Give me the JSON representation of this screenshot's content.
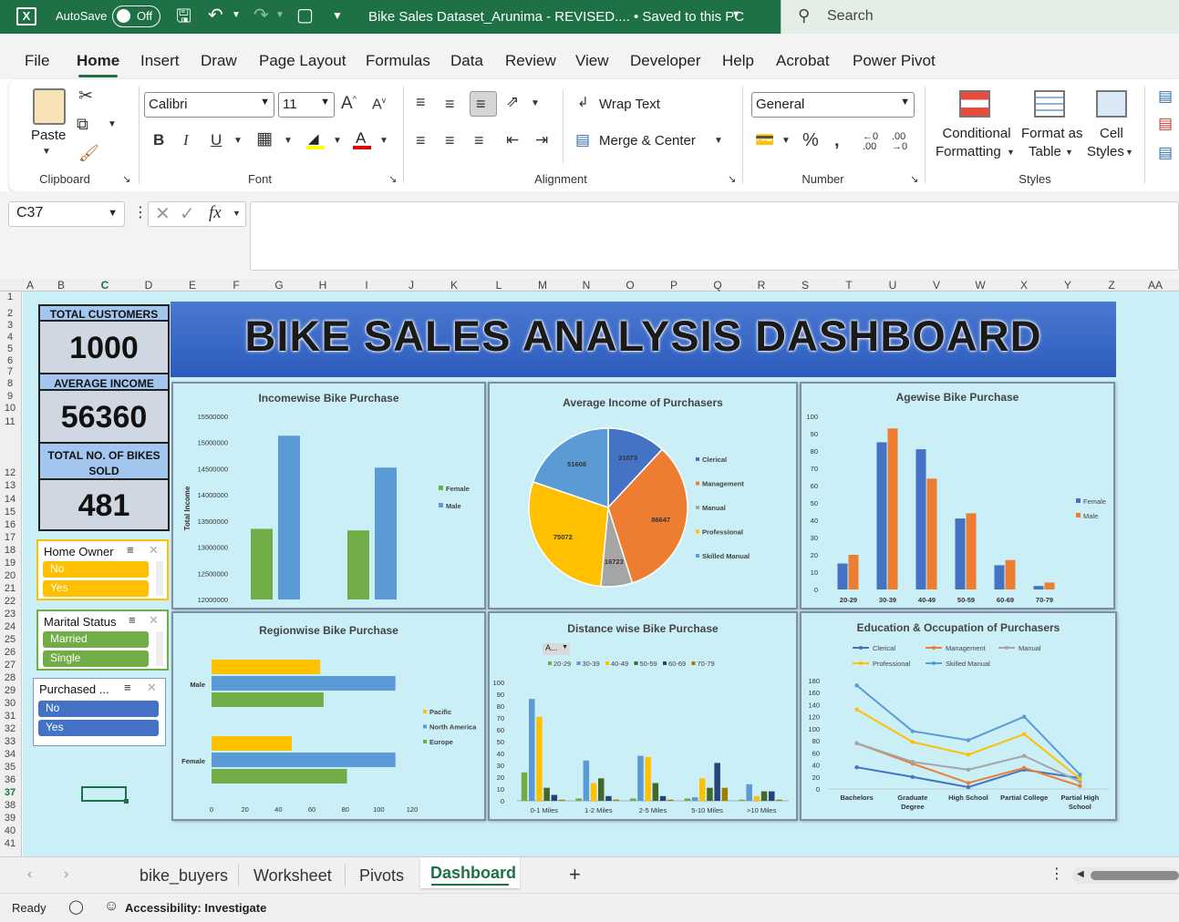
{
  "titlebar": {
    "autosave_label": "AutoSave",
    "autosave_state": "Off",
    "doc_title": "Bike Sales Dataset_Arunima - REVISED.... • Saved to this PC",
    "search_placeholder": "Search"
  },
  "menu": [
    "File",
    "Home",
    "Insert",
    "Draw",
    "Page Layout",
    "Formulas",
    "Data",
    "Review",
    "View",
    "Developer",
    "Help",
    "Acrobat",
    "Power Pivot"
  ],
  "ribbon": {
    "paste": "Paste",
    "clipboard": "Clipboard",
    "font_name": "Calibri",
    "font_size": "11",
    "font": "Font",
    "wrap_text": "Wrap Text",
    "merge_center": "Merge & Center",
    "alignment": "Alignment",
    "number_format": "General",
    "number": "Number",
    "cond_format_1": "Conditional",
    "cond_format_2": "Formatting",
    "format_table_1": "Format as",
    "format_table_2": "Table",
    "cell_styles_1": "Cell",
    "cell_styles_2": "Styles",
    "styles": "Styles"
  },
  "formula": {
    "name_box": "C37",
    "fx": "fx",
    "value": ""
  },
  "columns": [
    "A",
    "B",
    "C",
    "D",
    "E",
    "F",
    "G",
    "H",
    "I",
    "J",
    "K",
    "L",
    "M",
    "N",
    "O",
    "P",
    "Q",
    "R",
    "S",
    "T",
    "U",
    "V",
    "W",
    "X",
    "Y",
    "Z",
    "AA"
  ],
  "rows": [
    "1",
    "2",
    "3",
    "4",
    "5",
    "6",
    "7",
    "8",
    "9",
    "10",
    "11",
    "12",
    "13",
    "14",
    "15",
    "16",
    "17",
    "18",
    "19",
    "20",
    "21",
    "22",
    "23",
    "24",
    "25",
    "26",
    "27",
    "28",
    "29",
    "30",
    "31",
    "32",
    "33",
    "34",
    "35",
    "36",
    "37",
    "38",
    "39",
    "40",
    "41"
  ],
  "kpis": {
    "total_customers_label": "TOTAL CUSTOMERS",
    "total_customers": "1000",
    "avg_income_label": "AVERAGE INCOME",
    "avg_income": "56360",
    "bikes_sold_label_1": "TOTAL NO. OF BIKES",
    "bikes_sold_label_2": "SOLD",
    "bikes_sold": "481"
  },
  "slicers": {
    "home_owner": {
      "title": "Home Owner",
      "items": [
        "No",
        "Yes"
      ],
      "color": "#ffc000"
    },
    "marital_status": {
      "title": "Marital Status",
      "items": [
        "Married",
        "Single"
      ],
      "color": "#70ad47"
    },
    "purchased": {
      "title": "Purchased ...",
      "items": [
        "No",
        "Yes"
      ],
      "color": "#4472c4"
    }
  },
  "dashboard_title": "BIKE SALES ANALYSIS DASHBOARD",
  "charts": {
    "income": {
      "title": "Incomewise Bike Purchase",
      "ylabel": "Total Income",
      "ticks": [
        "15500000",
        "15000000",
        "14500000",
        "14000000",
        "13500000",
        "13000000",
        "12500000",
        "12000000"
      ],
      "legend": [
        "Female",
        "Male"
      ]
    },
    "pie": {
      "title": "Average Income of Purchasers",
      "legend": [
        "Clerical",
        "Management",
        "Manual",
        "Professional",
        "Skilled Manual"
      ]
    },
    "age": {
      "title": "Agewise Bike Purchase",
      "ticks": [
        "100",
        "90",
        "80",
        "70",
        "60",
        "50",
        "40",
        "30",
        "20",
        "10",
        "0"
      ],
      "legend": [
        "Female",
        "Male"
      ]
    },
    "region": {
      "title": "Regionwise Bike Purchase",
      "legend": [
        "Pacific",
        "North America",
        "Europe"
      ],
      "ticks": [
        "0",
        "20",
        "40",
        "60",
        "80",
        "100",
        "120"
      ]
    },
    "distance": {
      "title": "Distance wise Bike Purchase",
      "filter": "A...",
      "legend": [
        "20-29",
        "30-39",
        "40-49",
        "50-59",
        "60-69",
        "70-79"
      ],
      "ticks": [
        "100",
        "90",
        "80",
        "70",
        "60",
        "50",
        "40",
        "30",
        "20",
        "10",
        "0"
      ]
    },
    "education": {
      "title": "Education & Occupation of Purchasers",
      "legend": [
        "Clerical",
        "Management",
        "Manual",
        "Professional",
        "Skilled Manual"
      ],
      "ticks": [
        "180",
        "160",
        "140",
        "120",
        "100",
        "80",
        "60",
        "40",
        "20",
        "0"
      ]
    }
  },
  "chart_data": [
    {
      "type": "bar",
      "title": "Incomewise Bike Purchase",
      "ylabel": "Total Income",
      "ylim": [
        12000000,
        15500000
      ],
      "categories": [
        "",
        ""
      ],
      "series": [
        {
          "name": "Female",
          "values": [
            13350000,
            13320000
          ]
        },
        {
          "name": "Male",
          "values": [
            15130000,
            14520000
          ]
        }
      ]
    },
    {
      "type": "pie",
      "title": "Average Income of Purchasers",
      "categories": [
        "Clerical",
        "Management",
        "Manual",
        "Professional",
        "Skilled Manual"
      ],
      "values": [
        31073,
        86647,
        16723,
        75072,
        51608
      ]
    },
    {
      "type": "bar",
      "title": "Agewise Bike Purchase",
      "ylim": [
        0,
        100
      ],
      "categories": [
        "20-29",
        "30-39",
        "40-49",
        "50-59",
        "60-69",
        "70-79"
      ],
      "series": [
        {
          "name": "Female",
          "values": [
            15,
            85,
            81,
            41,
            14,
            2
          ]
        },
        {
          "name": "Male",
          "values": [
            20,
            93,
            64,
            44,
            17,
            4
          ]
        }
      ]
    },
    {
      "type": "bar",
      "title": "Regionwise Bike Purchase",
      "ylim": [
        0,
        120
      ],
      "categories": [
        "Male",
        "Female"
      ],
      "series": [
        {
          "name": "Pacific",
          "values": [
            65,
            48
          ]
        },
        {
          "name": "North America",
          "values": [
            110,
            110
          ]
        },
        {
          "name": "Europe",
          "values": [
            67,
            81
          ]
        }
      ]
    },
    {
      "type": "bar",
      "title": "Distance wise Bike Purchase",
      "ylim": [
        0,
        100
      ],
      "categories": [
        "0-1 Miles",
        "1-2 Miles",
        "2-5 Miles",
        "5-10 Miles",
        ">10 Miles"
      ],
      "series": [
        {
          "name": "20-29",
          "values": [
            24,
            2,
            2,
            2,
            1
          ]
        },
        {
          "name": "30-39",
          "values": [
            86,
            34,
            38,
            3,
            14
          ]
        },
        {
          "name": "40-49",
          "values": [
            71,
            15,
            37,
            19,
            4
          ]
        },
        {
          "name": "50-59",
          "values": [
            11,
            19,
            15,
            11,
            8
          ]
        },
        {
          "name": "60-69",
          "values": [
            5,
            4,
            4,
            32,
            8
          ]
        },
        {
          "name": "70-79",
          "values": [
            1,
            1,
            1,
            11,
            1
          ]
        }
      ]
    },
    {
      "type": "line",
      "title": "Education & Occupation of Purchasers",
      "ylim": [
        0,
        180
      ],
      "categories": [
        "Bachelors",
        "Graduate Degree",
        "High School",
        "Partial College",
        "Partial High School"
      ],
      "series": [
        {
          "name": "Clerical",
          "values": [
            36,
            20,
            3,
            32,
            18
          ]
        },
        {
          "name": "Management",
          "values": [
            76,
            42,
            10,
            35,
            5
          ]
        },
        {
          "name": "Manual",
          "values": [
            76,
            45,
            32,
            55,
            12
          ]
        },
        {
          "name": "Professional",
          "values": [
            132,
            78,
            57,
            91,
            17
          ]
        },
        {
          "name": "Skilled Manual",
          "values": [
            172,
            96,
            81,
            120,
            24
          ]
        }
      ]
    }
  ],
  "sheet_tabs": [
    "bike_buyers",
    "Worksheet",
    "Pivots",
    "Dashboard"
  ],
  "status": {
    "ready": "Ready",
    "accessibility": "Accessibility: Investigate"
  }
}
